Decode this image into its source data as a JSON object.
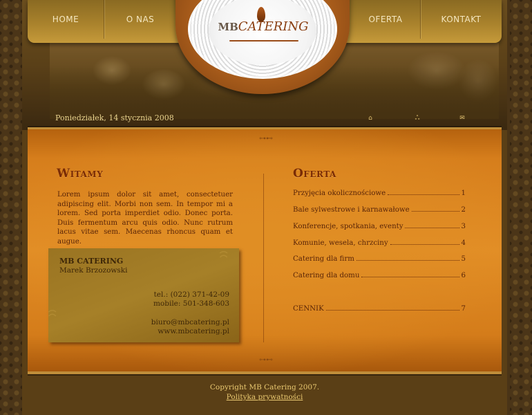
{
  "nav": {
    "home": "HOME",
    "about": "O NAS",
    "offer": "OFERTA",
    "contact": "KONTAKT"
  },
  "logo": {
    "mb": "MB",
    "catering": "CATERING"
  },
  "header": {
    "date": "Poniedziałek, 14 stycznia 2008",
    "icons": [
      "home-icon",
      "sitemap-icon",
      "mail-icon"
    ]
  },
  "welcome": {
    "title": "Witamy",
    "text": "Lorem ipsum dolor sit amet, consectetuer adipiscing elit. Morbi non sem. In tempor mi a lorem. Sed porta imperdiet odio. Donec porta. Duis fermentum arcu quis odio. Nunc rutrum lacus vitae sem. Maecenas rhoncus quam et augue."
  },
  "contact_card": {
    "company": "MB CATERING",
    "person": "Marek Brzozowski",
    "tel": "tel.: (022) 371-42-09",
    "mobile": "mobile: 501-348-603",
    "email": "biuro@mbcatering.pl",
    "web": "www.mbcatering.pl"
  },
  "offer": {
    "title": "Oferta",
    "items": [
      {
        "label": "Przyjęcia okolicznościowe",
        "num": "1"
      },
      {
        "label": "Bale sylwestrowe i karnawałowe",
        "num": "2"
      },
      {
        "label": "Konferencje, spotkania, eventy",
        "num": "3"
      },
      {
        "label": "Komunie, wesela, chrzciny",
        "num": "4"
      },
      {
        "label": "Catering dla firm",
        "num": "5"
      },
      {
        "label": "Catering dla domu",
        "num": "6"
      }
    ],
    "pricelist": {
      "label": "CENNIK",
      "num": "7"
    }
  },
  "footer": {
    "copyright": "Copyright MB Catering 2007.",
    "privacy": "Polityka prywatności"
  },
  "colors": {
    "accent": "#e28e26",
    "heading": "#7a2c05",
    "nav_gold": "#c59a3a",
    "background": "#4a3417"
  }
}
